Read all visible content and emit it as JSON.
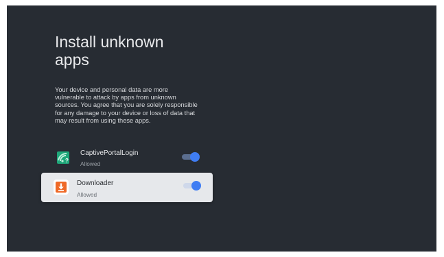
{
  "page": {
    "title": "Install unknown apps",
    "description": "Your device and personal data are more vulnerable to attack by apps from unknown sources. You agree that you are solely responsible for any damage to your device or loss of data that may result from using these apps."
  },
  "apps": [
    {
      "name": "CaptivePortalLogin",
      "status": "Allowed",
      "icon": "captive-portal-icon",
      "icon_glyph": "?",
      "enabled": true,
      "focused": false
    },
    {
      "name": "Downloader",
      "status": "Allowed",
      "icon": "downloader-icon",
      "icon_glyph": "⬇",
      "enabled": true,
      "focused": true
    }
  ],
  "colors": {
    "background": "#272c33",
    "accent": "#3f7df3",
    "focused_row": "#e6e8eb",
    "captive_icon": "#1fa77a",
    "downloader_icon": "#ef6a28"
  }
}
